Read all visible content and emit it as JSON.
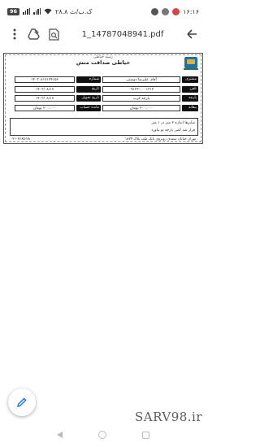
{
  "status_bar": {
    "time": "۱۶:۱۶",
    "speed": "۲۸.۸ ک.ب/ث",
    "battery": "96"
  },
  "toolbar": {
    "title": "1_14787048941.pdf"
  },
  "receipt": {
    "subtitle": "رسید خیاطی",
    "title": "خیاطی صداقت منش",
    "rows": [
      {
        "l1": "مشتری",
        "v1": "آقای علیرضا دوستی",
        "l2": "شماره",
        "v2": "۱۴۰۳۰۸۱۷۱۲۴۱۵۶"
      },
      {
        "l1": "تلفن",
        "v1": "۰۹۱۲۳-۰۰۰۱۳۱۳",
        "l2": "تاریخ",
        "v2": "۱۴۰۳/۰۸/۱۷"
      },
      {
        "l1": "پارچه",
        "v1": "پارچه کرپ",
        "l2": "تاریخ تحویل",
        "v2": "۱۴۰۳/۰۸/۱۷"
      },
      {
        "l1": "بیعانه",
        "v1": "۲۰۰،۰۰۰ تومان",
        "l2": "مانده حساب",
        "v2": "۲۰۰،۰۰۰ تومان"
      }
    ],
    "note1": "سایزها اندازه ۲ متر در ۱ متر",
    "note2": "قرار شد کمی پارچه نو بیاورد",
    "address": "تهران خیابان سعدی روبروی بانک ملت پلاک ۱۸۷۴",
    "phone": "۰۲۱-۶۶۶۵-۲۸"
  },
  "watermark": "SARV98.ir"
}
